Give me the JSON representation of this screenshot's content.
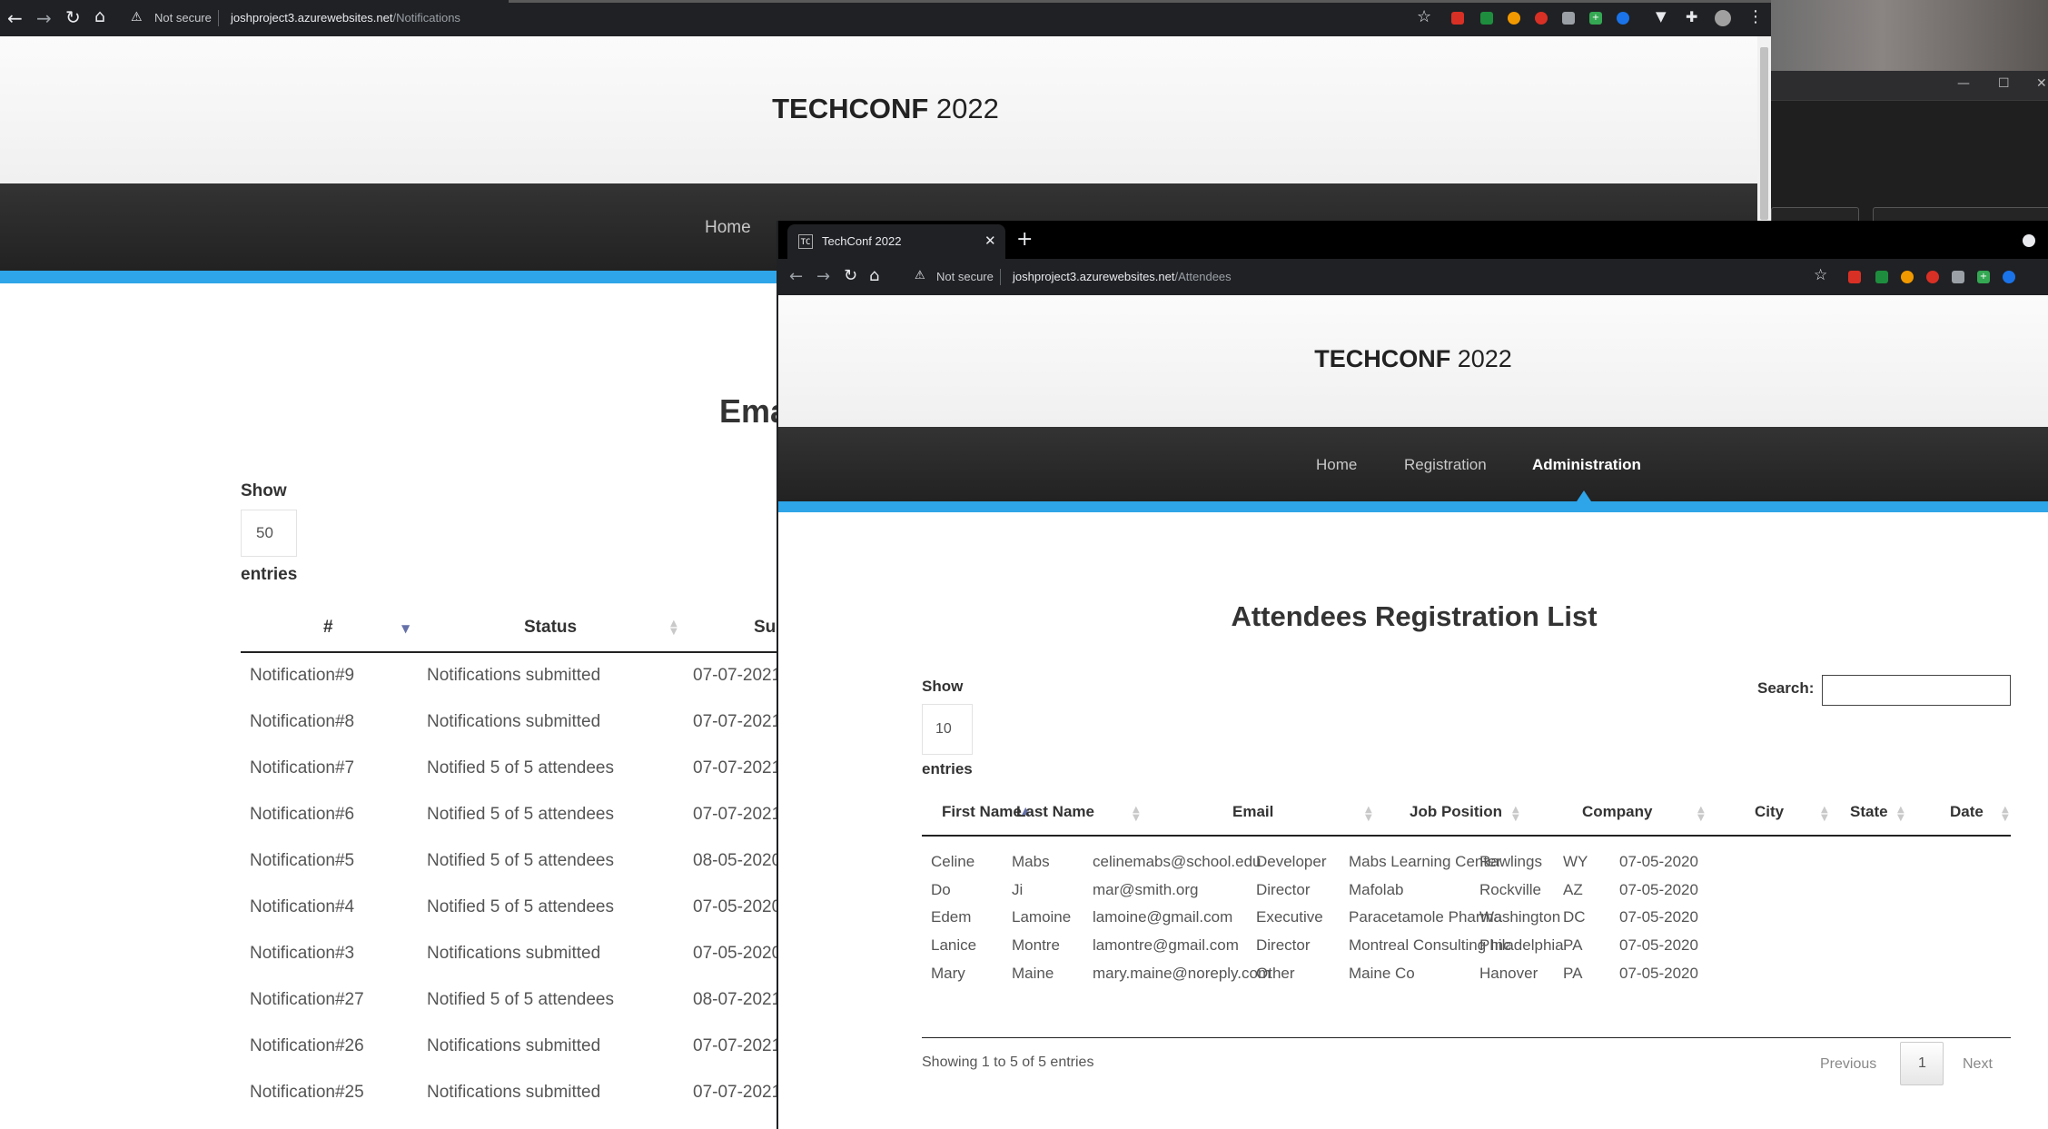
{
  "back_window": {
    "address_bar": {
      "security_text": "Not secure",
      "url_host": "joshproject3.azurewebsites.net",
      "url_path": "/Notifications"
    },
    "header": {
      "brand_bold": "TECHCONF",
      "brand_light": " 2022"
    },
    "nav": {
      "home": "Home"
    },
    "page_title_partial": "Ema",
    "length_control": {
      "show_label": "Show",
      "value": "50",
      "entries_label": "entries"
    },
    "table": {
      "headers": {
        "number": "#",
        "status": "Status",
        "submitted_partial": "Su"
      },
      "rows": [
        {
          "name": "Notification#9",
          "status": "Notifications submitted",
          "date": "07-07-2021"
        },
        {
          "name": "Notification#8",
          "status": "Notifications submitted",
          "date": "07-07-2021"
        },
        {
          "name": "Notification#7",
          "status": "Notified 5 of 5 attendees",
          "date": "07-07-2021"
        },
        {
          "name": "Notification#6",
          "status": "Notified 5 of 5 attendees",
          "date": "07-07-2021"
        },
        {
          "name": "Notification#5",
          "status": "Notified 5 of 5 attendees",
          "date": "08-05-2020"
        },
        {
          "name": "Notification#4",
          "status": "Notified 5 of 5 attendees",
          "date": "07-05-2020"
        },
        {
          "name": "Notification#3",
          "status": "Notifications submitted",
          "date": "07-05-2020"
        },
        {
          "name": "Notification#27",
          "status": "Notified 5 of 5 attendees",
          "date": "08-07-2021"
        },
        {
          "name": "Notification#26",
          "status": "Notifications submitted",
          "date": "07-07-2021"
        },
        {
          "name": "Notification#25",
          "status": "Notifications submitted",
          "date": "07-07-2021"
        }
      ]
    }
  },
  "front_window": {
    "tab": {
      "favicon": "TC",
      "title": "TechConf 2022"
    },
    "address_bar": {
      "security_text": "Not secure",
      "url_host": "joshproject3.azurewebsites.net",
      "url_path": "/Attendees"
    },
    "header": {
      "brand_bold": "TECHCONF",
      "brand_light": " 2022"
    },
    "nav": {
      "home": "Home",
      "registration": "Registration",
      "administration": "Administration"
    },
    "page_title": "Attendees Registration List",
    "length_control": {
      "show_label": "Show",
      "value": "10",
      "entries_label": "entries"
    },
    "search": {
      "label": "Search:",
      "value": ""
    },
    "table": {
      "headers": {
        "first_name": "First Name",
        "last_name": "Last Name",
        "email": "Email",
        "job_position": "Job Position",
        "company": "Company",
        "city": "City",
        "state": "State",
        "date": "Date"
      },
      "rows": [
        {
          "first": "Celine",
          "last": "Mabs",
          "email": "celinemabs@school.edu",
          "job": "Developer",
          "company": "Mabs Learning Center",
          "city": "Rawlings",
          "state": "WY",
          "date": "07-05-2020"
        },
        {
          "first": "Do",
          "last": "Ji",
          "email": "mar@smith.org",
          "job": "Director",
          "company": "Mafolab",
          "city": "Rockville",
          "state": "AZ",
          "date": "07-05-2020"
        },
        {
          "first": "Edem",
          "last": "Lamoine",
          "email": "lamoine@gmail.com",
          "job": "Executive",
          "company": "Paracetamole Pharma",
          "city": "Washington",
          "state": "DC",
          "date": "07-05-2020"
        },
        {
          "first": "Lanice",
          "last": "Montre",
          "email": "lamontre@gmail.com",
          "job": "Director",
          "company": "Montreal Consulting Inc",
          "city": "Philadelphia",
          "state": "PA",
          "date": "07-05-2020"
        },
        {
          "first": "Mary",
          "last": "Maine",
          "email": "mary.maine@noreply.com",
          "job": "Other",
          "company": "Maine Co",
          "city": "Hanover",
          "state": "PA",
          "date": "07-05-2020"
        }
      ]
    },
    "info": "Showing 1 to 5 of 5 entries",
    "pagination": {
      "previous": "Previous",
      "page": "1",
      "next": "Next"
    }
  },
  "colors": {
    "accent_blue": "#2ea5e8",
    "nav_dark": "#2a2a2a",
    "chrome_dark": "#202124"
  }
}
